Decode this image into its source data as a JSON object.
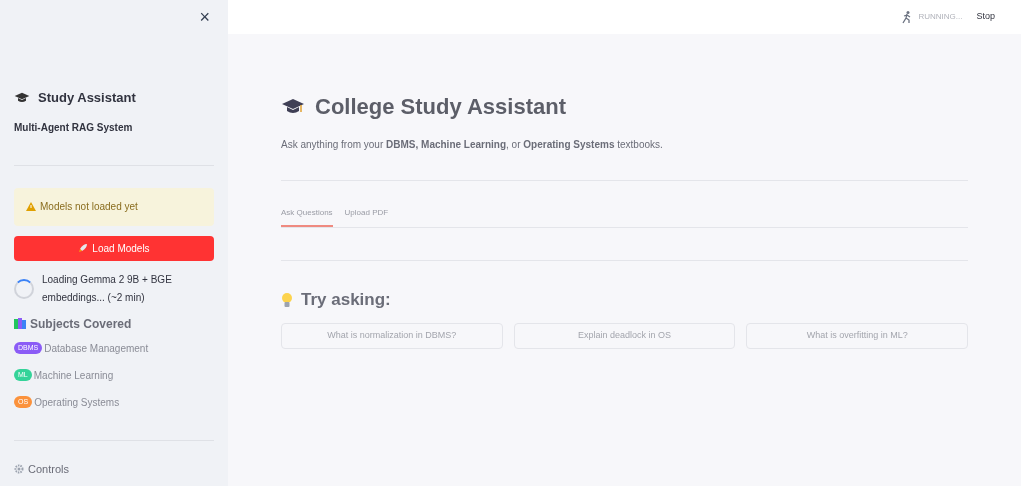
{
  "sidebar": {
    "close": "×",
    "title": "Study Assistant",
    "subtitle": "Multi-Agent RAG System",
    "warning": "Models not loaded yet",
    "load_button": "Load Models",
    "spinner_text": "Loading Gemma 2 9B + BGE embeddings... (~2 min)",
    "subjects_heading": "Subjects Covered",
    "subjects": [
      {
        "badge": "DBMS",
        "label": "Database Management",
        "color": "#8b5cf6"
      },
      {
        "badge": "ML",
        "label": "Machine Learning",
        "color": "#34d399"
      },
      {
        "badge": "OS",
        "label": "Operating Systems",
        "color": "#fb923c"
      }
    ],
    "controls_heading": "Controls"
  },
  "header": {
    "status": "RUNNING...",
    "stop": "Stop"
  },
  "main": {
    "title": "College Study Assistant",
    "description": "Ask anything from your **DBMS, Machine Learning**, or **Operating Systems** textbooks.",
    "tabs": [
      {
        "label": "Ask Questions",
        "selected": true
      },
      {
        "label": "Upload PDF",
        "selected": false
      }
    ],
    "try_heading": "Try asking:",
    "suggestions": [
      "What is normalization in DBMS?",
      "Explain deadlock in OS",
      "What is overfitting in ML?"
    ]
  }
}
